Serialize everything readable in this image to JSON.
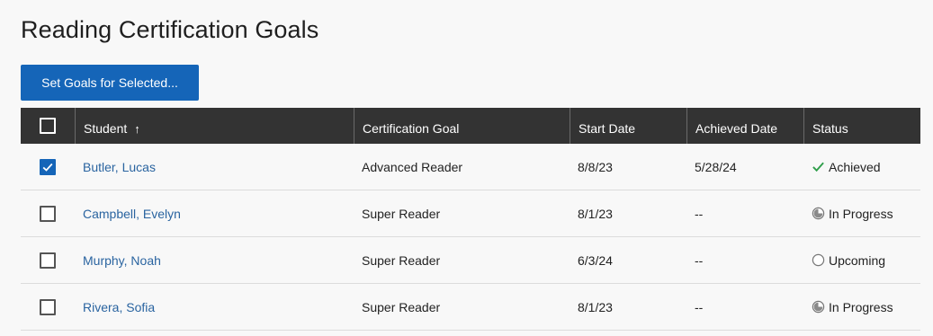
{
  "page": {
    "title": "Reading Certification Goals"
  },
  "toolbar": {
    "set_goals_label": "Set Goals for Selected..."
  },
  "colors": {
    "primary": "#1565b8",
    "header_bg": "#333333",
    "link": "#2a64a0",
    "achieved_green": "#2e9e4a",
    "icon_gray": "#777777"
  },
  "table": {
    "headers": {
      "student": "Student",
      "goal": "Certification Goal",
      "start": "Start Date",
      "achieved": "Achieved Date",
      "status": "Status"
    },
    "sort_icon": "arrow-up-icon",
    "rows": [
      {
        "checked": true,
        "student": "Butler, Lucas",
        "goal": "Advanced Reader",
        "start": "8/8/23",
        "achieved": "5/28/24",
        "status": "Achieved",
        "status_icon": "checkmark-icon"
      },
      {
        "checked": false,
        "student": "Campbell, Evelyn",
        "goal": "Super Reader",
        "start": "8/1/23",
        "achieved": "--",
        "status": "In Progress",
        "status_icon": "half-circle-icon"
      },
      {
        "checked": false,
        "student": "Murphy, Noah",
        "goal": "Super Reader",
        "start": "6/3/24",
        "achieved": "--",
        "status": "Upcoming",
        "status_icon": "empty-circle-icon"
      },
      {
        "checked": false,
        "student": "Rivera, Sofia",
        "goal": "Super Reader",
        "start": "8/1/23",
        "achieved": "--",
        "status": "In Progress",
        "status_icon": "half-circle-icon"
      }
    ]
  }
}
